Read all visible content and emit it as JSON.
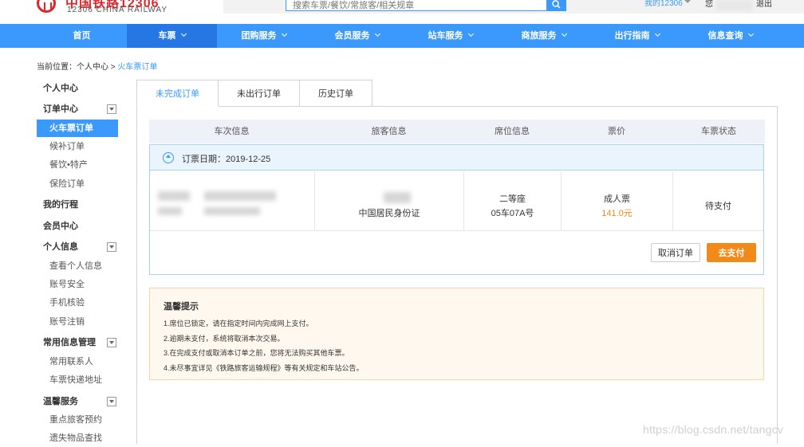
{
  "header": {
    "logo_cn": "中国铁路12306",
    "logo_en": "12306 CHINA RAILWAY",
    "search_placeholder": "搜索车票/餐饮/常旅客/相关规章",
    "my12306": "我的12306",
    "greeting": "您",
    "logout": "退出"
  },
  "nav": [
    {
      "label": "首页"
    },
    {
      "label": "车票"
    },
    {
      "label": "团购服务"
    },
    {
      "label": "会员服务"
    },
    {
      "label": "站车服务"
    },
    {
      "label": "商旅服务"
    },
    {
      "label": "出行指南"
    },
    {
      "label": "信息查询"
    }
  ],
  "breadcrumb": {
    "prefix": "当前位置：",
    "parent": "个人中心",
    "sep": " > ",
    "current": "火车票订单"
  },
  "sidebar": [
    {
      "label": "个人中心"
    },
    {
      "label": "订单中心"
    },
    {
      "label": "火车票订单"
    },
    {
      "label": "候补订单"
    },
    {
      "label": "餐饮•特产"
    },
    {
      "label": "保险订单"
    },
    {
      "label": "我的行程"
    },
    {
      "label": "会员中心"
    },
    {
      "label": "个人信息"
    },
    {
      "label": "查看个人信息"
    },
    {
      "label": "账号安全"
    },
    {
      "label": "手机核验"
    },
    {
      "label": "账号注销"
    },
    {
      "label": "常用信息管理"
    },
    {
      "label": "常用联系人"
    },
    {
      "label": "车票快递地址"
    },
    {
      "label": "温馨服务"
    },
    {
      "label": "重点旅客预约"
    },
    {
      "label": "遗失物品查找"
    }
  ],
  "tabs": [
    {
      "label": "未完成订单"
    },
    {
      "label": "未出行订单"
    },
    {
      "label": "历史订单"
    }
  ],
  "table": {
    "headers": [
      "车次信息",
      "旅客信息",
      "席位信息",
      "票价",
      "车票状态"
    ]
  },
  "order": {
    "date_label": "订票日期：",
    "date": "2019-12-25",
    "passenger_id_type": "中国居民身份证",
    "seat_class": "二等座",
    "seat_no": "05车07A号",
    "ticket_type": "成人票",
    "price": "141.0元",
    "status": "待支付",
    "cancel_label": "取消订单",
    "pay_label": "去支付"
  },
  "tips": {
    "title": "温馨提示",
    "lines": [
      "1.席位已锁定，请在指定时间内完成网上支付。",
      "2.逾期未支付，系统将取消本次交易。",
      "3.在完成支付或取消本订单之前，您将无法购买其他车票。",
      "4.未尽事宜详见《铁路旅客运输规程》等有关规定和车站公告。"
    ]
  },
  "watermark": "https://blog.csdn.net/tangcv",
  "colors": {
    "primary": "#3b99fc",
    "nav_active": "#2676e3",
    "orange": "#f28a1a",
    "tips_bg": "#fef8ee"
  }
}
